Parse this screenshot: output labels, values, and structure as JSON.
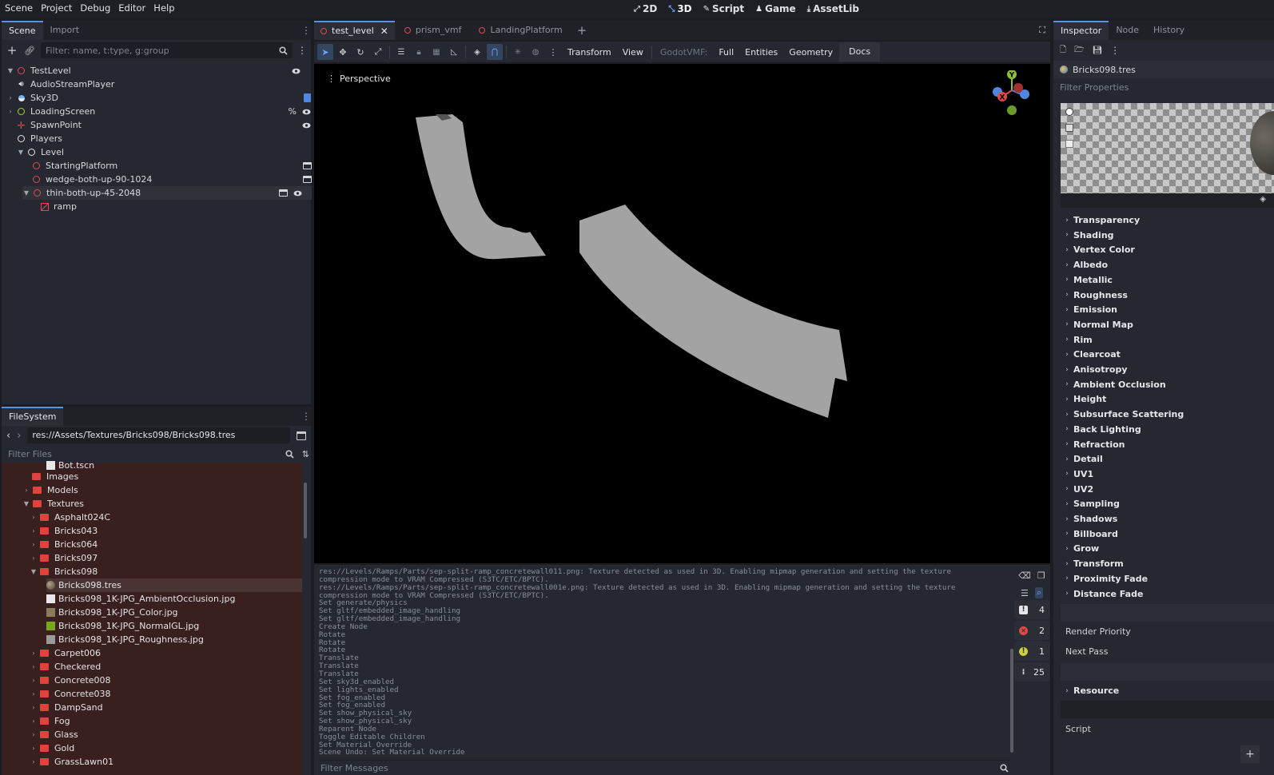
{
  "menu": [
    "Scene",
    "Project",
    "Debug",
    "Editor",
    "Help"
  ],
  "workspaces": [
    {
      "label": "2D",
      "icon": "2d-icon"
    },
    {
      "label": "3D",
      "icon": "3d-icon",
      "active": true
    },
    {
      "label": "Script",
      "icon": "script-icon"
    },
    {
      "label": "Game",
      "icon": "game-icon"
    },
    {
      "label": "AssetLib",
      "icon": "assetlib-icon"
    }
  ],
  "scene_panel": {
    "tabs": [
      "Scene",
      "Import"
    ],
    "filter_placeholder": "Filter: name, t:type, g:group",
    "nodes": [
      {
        "label": "TestLevel",
        "icon": "node3d-icon"
      },
      {
        "label": "AudioStreamPlayer",
        "icon": "audio-icon"
      },
      {
        "label": "Sky3D",
        "icon": "sky-icon"
      },
      {
        "label": "LoadingScreen",
        "icon": "control-icon",
        "extra": "%"
      },
      {
        "label": "SpawnPoint",
        "icon": "marker-icon"
      },
      {
        "label": "Players",
        "icon": "node-icon"
      },
      {
        "label": "Level",
        "icon": "node-icon"
      },
      {
        "label": "StartingPlatform",
        "icon": "node3d-icon"
      },
      {
        "label": "wedge-both-up-90-1024",
        "icon": "node3d-icon"
      },
      {
        "label": "thin-both-up-45-2048",
        "icon": "node3d-icon"
      },
      {
        "label": "ramp",
        "icon": "mesh-icon"
      }
    ]
  },
  "filesystem": {
    "tab": "FileSystem",
    "path": "res://Assets/Textures/Bricks098/Bricks098.tres",
    "filter_placeholder": "Filter Files",
    "partial_top": "Bot.tscn",
    "items": [
      {
        "label": "Images",
        "type": "folder"
      },
      {
        "label": "Models",
        "type": "folder"
      },
      {
        "label": "Textures",
        "type": "folder"
      },
      {
        "label": "Asphalt024C",
        "type": "folder"
      },
      {
        "label": "Bricks043",
        "type": "folder"
      },
      {
        "label": "Bricks064",
        "type": "folder"
      },
      {
        "label": "Bricks097",
        "type": "folder"
      },
      {
        "label": "Bricks098",
        "type": "folder"
      },
      {
        "label": "Bricks098.tres",
        "type": "material"
      },
      {
        "label": "Bricks098_1K-JPG_AmbientOcclusion.jpg",
        "type": "image",
        "color": "#e8e8e8"
      },
      {
        "label": "Bricks098_1K-JPG_Color.jpg",
        "type": "image",
        "color": "#8a7b5c"
      },
      {
        "label": "Bricks098_1K-JPG_NormalGL.jpg",
        "type": "image",
        "color": "#7aa61d"
      },
      {
        "label": "Bricks098_1K-JPG_Roughness.jpg",
        "type": "image",
        "color": "#9a9a9a"
      },
      {
        "label": "Carpet006",
        "type": "folder"
      },
      {
        "label": "Checkered",
        "type": "folder"
      },
      {
        "label": "Concrete008",
        "type": "folder"
      },
      {
        "label": "Concrete038",
        "type": "folder"
      },
      {
        "label": "DampSand",
        "type": "folder"
      },
      {
        "label": "Fog",
        "type": "folder"
      },
      {
        "label": "Glass",
        "type": "folder"
      },
      {
        "label": "Gold",
        "type": "folder"
      },
      {
        "label": "GrassLawn01",
        "type": "folder"
      }
    ]
  },
  "editor_tabs": [
    {
      "label": "test_level",
      "active": true
    },
    {
      "label": "prism_vmf"
    },
    {
      "label": "LandingPlatform"
    }
  ],
  "viewport_toolbar": {
    "transform": "Transform",
    "view": "View",
    "godotvmf": "GodotVMF:",
    "full": "Full",
    "entities": "Entities",
    "geometry": "Geometry",
    "docs": "Docs"
  },
  "viewport": {
    "label": "Perspective",
    "gizmo_y": "Y",
    "gizmo_x": "X"
  },
  "output": {
    "lines": [
      "res://Levels/Ramps/Parts/sep-split-ramp_concretewall011.png: Texture detected as used in 3D. Enabling mipmap generation and setting the texture",
      "compression mode to VRAM Compressed (S3TC/ETC/BPTC).",
      "res://Levels/Ramps/Parts/sep-split-ramp_concretewall001e.png: Texture detected as used in 3D. Enabling mipmap generation and setting the texture",
      "compression mode to VRAM Compressed (S3TC/ETC/BPTC).",
      "Set generate/physics",
      "Set gltf/embedded_image_handling",
      "Set gltf/embedded_image_handling",
      "Create Node",
      "Rotate",
      "Rotate",
      "Rotate",
      "Translate",
      "Translate",
      "Translate",
      "Set sky3d_enabled",
      "Set lights_enabled",
      "Set fog_enabled",
      "Set fog_enabled",
      "Set show_physical_sky",
      "Set show_physical_sky",
      "Reparent Node",
      "Toggle Editable Children",
      "Set Material Override",
      "Scene Undo: Set Material Override"
    ],
    "filter_placeholder": "Filter Messages",
    "counts": {
      "messages": "4",
      "errors": "2",
      "warnings": "1",
      "info": "25"
    }
  },
  "inspector": {
    "tabs": [
      "Inspector",
      "Node",
      "History"
    ],
    "resource": "Bricks098.tres",
    "filter_placeholder": "Filter Properties",
    "sections": [
      "Transparency",
      "Shading",
      "Vertex Color",
      "Albedo",
      "Metallic",
      "Roughness",
      "Emission",
      "Normal Map",
      "Rim",
      "Clearcoat",
      "Anisotropy",
      "Ambient Occlusion",
      "Height",
      "Subsurface Scattering",
      "Back Lighting",
      "Refraction",
      "Detail",
      "UV1",
      "UV2",
      "Sampling",
      "Shadows",
      "Billboard",
      "Grow",
      "Transform",
      "Proximity Fade",
      "Distance Fade"
    ],
    "render_priority": "Render Priority",
    "next_pass": "Next Pass",
    "resource_section": "Resource",
    "script": "Script"
  },
  "colors": {
    "accent": "#5b8fe0",
    "node_red": "#e04a4a",
    "folder_red": "#e0433d",
    "mesh_gray": "#a3a3a3"
  }
}
